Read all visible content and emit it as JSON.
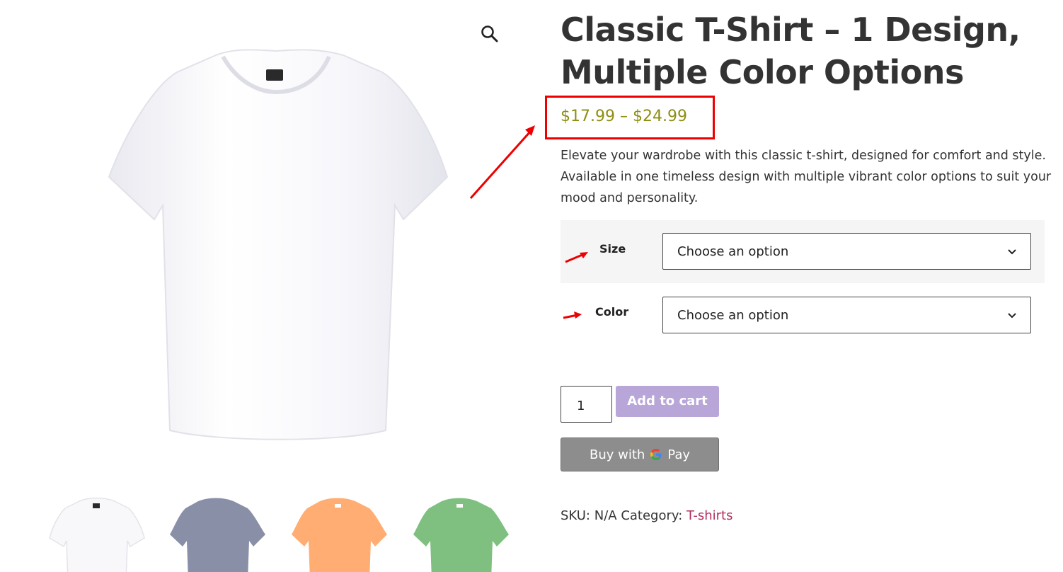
{
  "product": {
    "title": "Classic T-Shirt – 1 Design, Multiple Color Options",
    "price": "$17.99 – $24.99",
    "description": "Elevate your wardrobe with this classic t-shirt, designed for comfort and style. Available in one timeless design with multiple vibrant color options to suit your mood and personality."
  },
  "variations": {
    "size_label": "Size",
    "size_value": "Choose an option",
    "color_label": "Color",
    "color_value": "Choose an option"
  },
  "cart": {
    "quantity": "1",
    "add_to_cart": "Add to cart",
    "gpay_prefix": "Buy with",
    "gpay_suffix": "Pay"
  },
  "meta": {
    "sku_label": "SKU:",
    "sku_value": "N/A",
    "category_label": "Category:",
    "category_value": "T-shirts"
  },
  "gallery": {
    "thumbnail_colors": [
      "#ffffff",
      "#8a8fa8",
      "#ffad73",
      "#7fc080"
    ]
  },
  "icons": {
    "zoom": "magnifier-icon",
    "dropdown": "chevron-down-icon"
  },
  "colors": {
    "price": "#8e8e12",
    "add_to_cart_bg": "#b8a6d8",
    "gpay_bg": "#8d8d8d",
    "category_link": "#b12e5e",
    "annotation": "#ee0000"
  }
}
